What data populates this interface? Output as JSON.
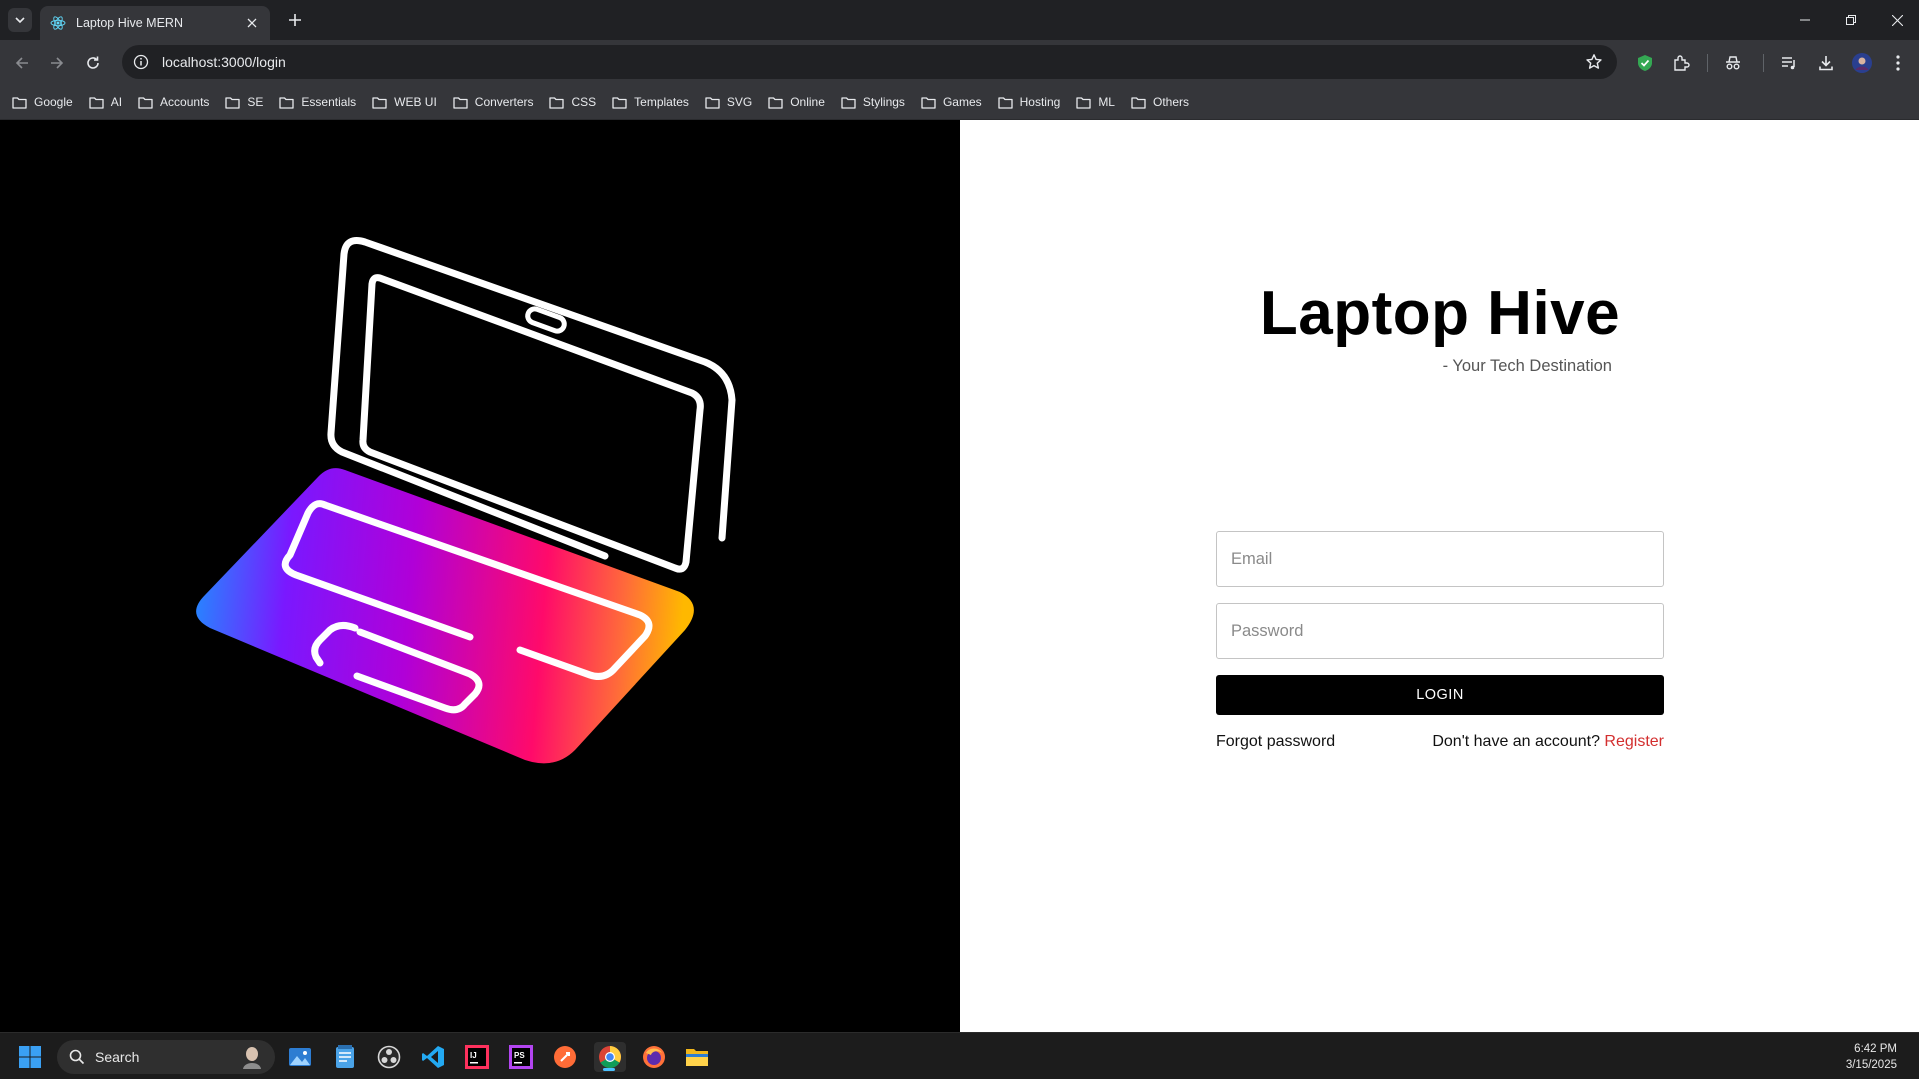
{
  "browser": {
    "tab_title": "Laptop Hive MERN",
    "url": "localhost:3000/login",
    "bookmarks": [
      "Google",
      "AI",
      "Accounts",
      "SE",
      "Essentials",
      "WEB UI",
      "Converters",
      "CSS",
      "Templates",
      "SVG",
      "Online",
      "Stylings",
      "Games",
      "Hosting",
      "ML",
      "Others"
    ]
  },
  "login": {
    "title": "Laptop Hive",
    "tagline": "- Your Tech Destination",
    "email_placeholder": "Email",
    "password_placeholder": "Password",
    "login_button": "LOGIN",
    "forgot_password": "Forgot password",
    "no_account": "Don't have an account?",
    "register": "Register"
  },
  "taskbar": {
    "search_label": "Search",
    "time": "6:42 PM",
    "date": "3/15/2025"
  },
  "colors": {
    "accent_register": "#d32f2f",
    "button_bg": "#000000",
    "gradient": [
      "#1e90ff",
      "#8b00ff",
      "#e0006f",
      "#ff1a5e",
      "#ffb000"
    ]
  }
}
